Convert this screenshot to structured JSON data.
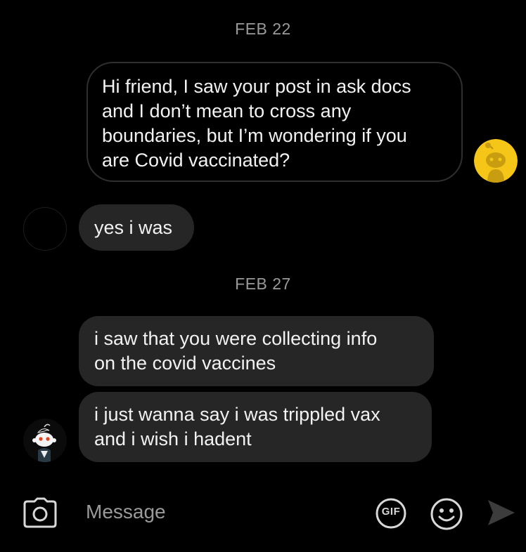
{
  "conversation": {
    "date_1": "FEB 22",
    "date_2": "FEB 27",
    "messages": [
      {
        "sender": "me",
        "lines": [
          "Hi friend, I saw your post in ask docs",
          "and I don’t mean to cross any",
          "boundaries, but I’m wondering if you",
          "are Covid vaccinated?"
        ]
      },
      {
        "sender": "them",
        "lines": [
          "yes i was"
        ]
      },
      {
        "sender": "them",
        "lines": [
          "i saw that you were collecting info",
          "on the covid vaccines"
        ]
      },
      {
        "sender": "them",
        "lines": [
          "i just wanna say i was trippled vax",
          "and i wish i hadent"
        ]
      }
    ]
  },
  "composer": {
    "placeholder": "Message",
    "gif_label": "GIF",
    "icons": [
      "camera-icon",
      "gif-icon",
      "emoji-icon",
      "send-icon"
    ]
  },
  "colors": {
    "background": "#000000",
    "incoming_bubble": "#262626",
    "outgoing_border": "#2f2f2f",
    "muted_text": "#9a9a9a",
    "avatar_yellow": "#f5c518"
  }
}
